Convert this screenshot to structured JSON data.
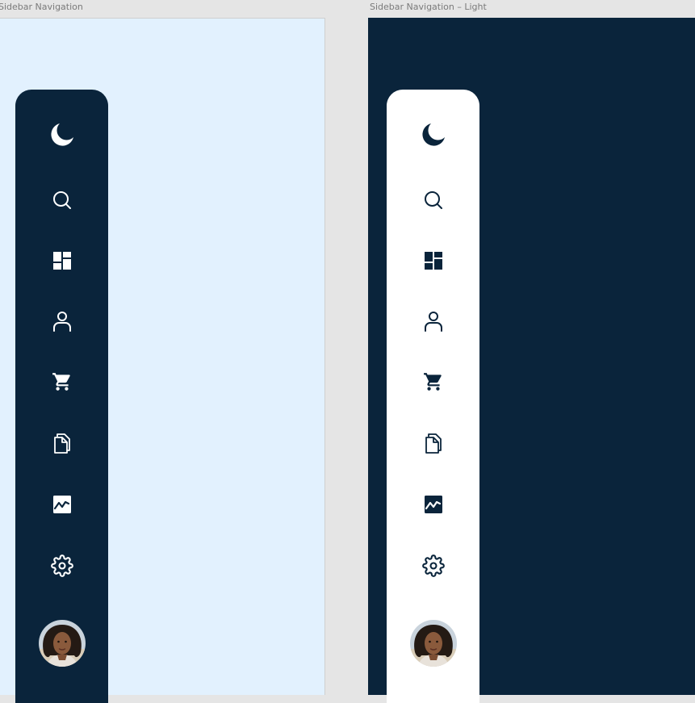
{
  "frames": [
    {
      "label": "Sidebar Navigation",
      "background": "#e2f1fe",
      "sidebar_color": "#0a243b",
      "icon_color": "#ffffff",
      "items": [
        "theme-moon-icon",
        "search-icon",
        "dashboard-icon",
        "user-icon",
        "cart-icon",
        "documents-icon",
        "analytics-icon",
        "settings-gear-icon",
        "profile-avatar"
      ]
    },
    {
      "label": "Sidebar Navigation – Light",
      "background": "#0a243b",
      "sidebar_color": "#ffffff",
      "icon_color": "#0a243b",
      "items": [
        "theme-moon-icon",
        "search-icon",
        "dashboard-icon",
        "user-icon",
        "cart-icon",
        "documents-icon",
        "analytics-icon",
        "settings-gear-icon",
        "profile-avatar"
      ]
    }
  ]
}
